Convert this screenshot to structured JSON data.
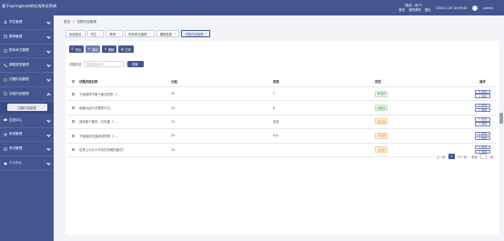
{
  "header": {
    "app_title": "基于springboot的在线考试系统",
    "user_role": "（角色：用户）",
    "link_home": "首页",
    "link_profile": "我的资料",
    "link_logout": "退出",
    "datetime": "2024-1-16 18:59:45",
    "admin_name": "admin"
  },
  "sidebar": {
    "items": [
      {
        "label": "学生管理",
        "icon": "user-icon"
      },
      {
        "label": "教师管理",
        "icon": "teacher-icon"
      },
      {
        "label": "院系考试管理",
        "icon": "exam-icon"
      },
      {
        "label": "课程类型管理",
        "icon": "category-icon"
      },
      {
        "label": "试题内容管理",
        "icon": "question-icon"
      },
      {
        "label": "试卷内容管理",
        "icon": "paper-icon",
        "open": true
      },
      {
        "label": "交流中心",
        "icon": "chat-icon"
      },
      {
        "label": "系统管理",
        "icon": "settings-icon"
      },
      {
        "label": "考试管理",
        "icon": "exam-manage-icon"
      },
      {
        "label": "个人中心",
        "icon": "profile-icon"
      }
    ],
    "submenu_label": "试题内容管理"
  },
  "breadcrumb": {
    "home": "首页",
    "sep": "/",
    "current": "试题内容管理"
  },
  "tabs": [
    {
      "label": "系统首页",
      "closable": false
    },
    {
      "label": "学生",
      "closable": true
    },
    {
      "label": "教师",
      "closable": true
    },
    {
      "label": "院系考试管理",
      "closable": true
    },
    {
      "label": "课程类型",
      "closable": true
    },
    {
      "label": "试题内容管理",
      "closable": true,
      "active": true
    }
  ],
  "toolbar": {
    "export_label": "导出",
    "add_label": "添加",
    "delete_label": "删除",
    "stat_label": "打印"
  },
  "search": {
    "label": "试题内容",
    "placeholder": "试题内容名称",
    "button_label": "搜索"
  },
  "table": {
    "headers": [
      "试题内容名称",
      "分值",
      "答案",
      "类型",
      "操作"
    ],
    "rows": [
      {
        "name": "下面选项不属于面试的是（）。",
        "score": "20",
        "answer": "C",
        "type": "单选题",
        "type_color": "green"
      },
      {
        "name": "说截大运行过程的不正。",
        "score": "20",
        "answer": "B",
        "type": "判断题",
        "type_color": "green"
      },
      {
        "name": "我说客个格本，分布建（）。",
        "score": "20",
        "answer": "你说",
        "type": "填空题",
        "type_color": "orange"
      },
      {
        "name": "下面选择生面测试时等（）。",
        "score": "20",
        "answer": "A,B",
        "type": "多选题",
        "type_color": "orange"
      },
      {
        "name": "世界上为什么不存在完美的面试?",
        "score": "20",
        "answer": "",
        "type": "主观题",
        "type_color": "orange"
      }
    ],
    "op_edit": "修改",
    "op_delete": "删除"
  },
  "pagination": {
    "prev": "上一页",
    "current": "1",
    "next": "下一页",
    "goto": "前往",
    "page_suffix": "页"
  },
  "colors": {
    "primary": "#435690",
    "badge_green": "#3a9a3a",
    "badge_orange": "#d9862a"
  }
}
